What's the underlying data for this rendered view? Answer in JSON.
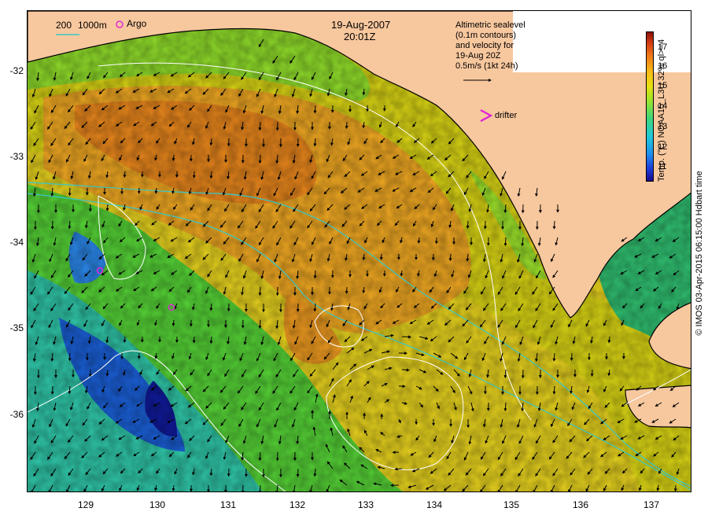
{
  "map": {
    "date_label": "19-Aug-2007",
    "time_label": "20:01Z",
    "bathy_labels": [
      "200",
      "1000m"
    ],
    "argo_label": "Argo",
    "drifter_label": "drifter",
    "altimetry_note": [
      "Altimetric sealevel",
      "(0.1m contours)",
      "and velocity for",
      "19-Aug 20Z",
      "0.5m/s (1kt 24h)"
    ],
    "credit": "© IMOS 03-Apr-2015 06:15:00 Hdbart time",
    "lat_ticks": [
      "-32",
      "-33",
      "-34",
      "-35",
      "-36"
    ],
    "lon_ticks": [
      "129",
      "130",
      "131",
      "132",
      "133",
      "134",
      "135",
      "136",
      "137"
    ],
    "colors": {
      "land": "#f7c79e",
      "coast": "#000000",
      "contour": "#ffffff",
      "bathy": "#38c8c8",
      "argo": "#e02ad8",
      "drifter": "#e020d8"
    }
  },
  "colorbar": {
    "title": "Temp. (°C) NOAA15_L3U 32% ql>=4",
    "ticks": [
      "17",
      "16",
      "15",
      "14",
      "13",
      "12",
      "11"
    ],
    "colors": [
      "#1a0a8c",
      "#1b3ad8",
      "#1e8ef0",
      "#20c9d8",
      "#3fd67a",
      "#9be52a",
      "#e8e010",
      "#f8b818",
      "#f07a16",
      "#d23a12",
      "#8a1008"
    ]
  }
}
